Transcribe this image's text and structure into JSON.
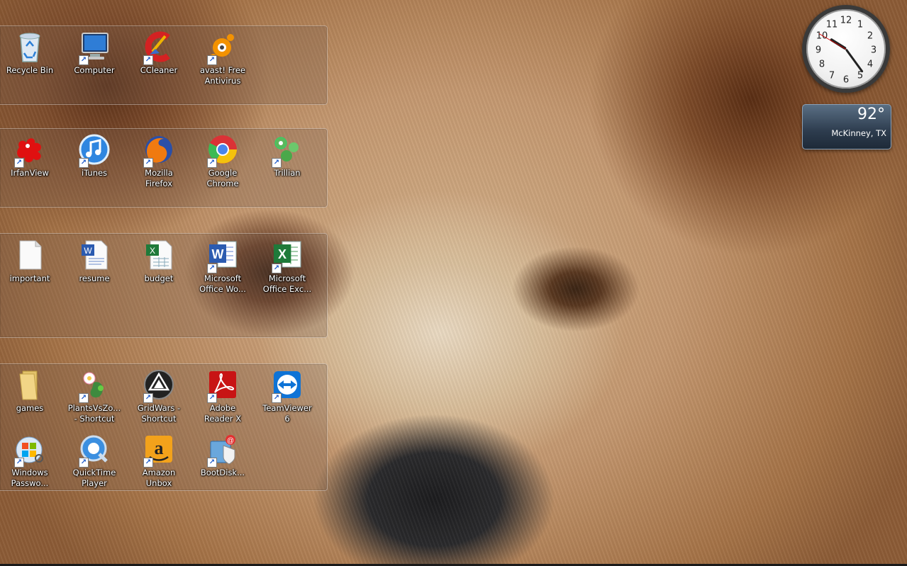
{
  "desktop": {
    "icons": [
      {
        "label": "Recycle Bin",
        "icon": "recycle-bin-icon",
        "shortcut": false
      },
      {
        "label": "Computer",
        "icon": "computer-icon",
        "shortcut": true
      },
      {
        "label": "CCleaner",
        "icon": "ccleaner-icon",
        "shortcut": true
      },
      {
        "label": "avast! Free\nAntivirus",
        "icon": "avast-icon",
        "shortcut": true
      },
      {
        "label": "IrfanView",
        "icon": "irfanview-icon",
        "shortcut": true
      },
      {
        "label": "iTunes",
        "icon": "itunes-icon",
        "shortcut": true
      },
      {
        "label": "Mozilla\nFirefox",
        "icon": "firefox-icon",
        "shortcut": true
      },
      {
        "label": "Google\nChrome",
        "icon": "chrome-icon",
        "shortcut": true
      },
      {
        "label": "Trillian",
        "icon": "trillian-icon",
        "shortcut": true
      },
      {
        "label": "important",
        "icon": "text-document-icon",
        "shortcut": false
      },
      {
        "label": "resume",
        "icon": "word-document-icon",
        "shortcut": false
      },
      {
        "label": "budget",
        "icon": "excel-document-icon",
        "shortcut": false
      },
      {
        "label": "Microsoft\nOffice Wo...",
        "icon": "word-icon",
        "shortcut": true
      },
      {
        "label": "Microsoft\nOffice Exc...",
        "icon": "excel-icon",
        "shortcut": true
      },
      {
        "label": "games",
        "icon": "folder-icon",
        "shortcut": false
      },
      {
        "label": "PlantsVsZo...\n- Shortcut",
        "icon": "plants-vs-zombies-icon",
        "shortcut": true
      },
      {
        "label": "GridWars -\nShortcut",
        "icon": "gridwars-icon",
        "shortcut": true
      },
      {
        "label": "Adobe\nReader X",
        "icon": "adobe-reader-icon",
        "shortcut": true
      },
      {
        "label": "TeamViewer\n6",
        "icon": "teamviewer-icon",
        "shortcut": true
      },
      {
        "label": "Windows\nPasswo...",
        "icon": "windows-password-icon",
        "shortcut": true
      },
      {
        "label": "QuickTime\nPlayer",
        "icon": "quicktime-icon",
        "shortcut": true
      },
      {
        "label": "Amazon\nUnbox",
        "icon": "amazon-unbox-icon",
        "shortcut": true
      },
      {
        "label": "BootDisk...",
        "icon": "bootdisk-icon",
        "shortcut": true
      }
    ]
  },
  "gadgets": {
    "clock": {
      "numbers": [
        "12",
        "1",
        "2",
        "3",
        "4",
        "5",
        "6",
        "7",
        "8",
        "9",
        "10",
        "11"
      ],
      "time": "10:24"
    },
    "weather": {
      "temperature": "92°",
      "location": "McKinney, TX"
    }
  },
  "colors": {
    "weather_bg": "#2d3c4e",
    "fence_bg": "rgba(120,95,80,0.28)"
  }
}
